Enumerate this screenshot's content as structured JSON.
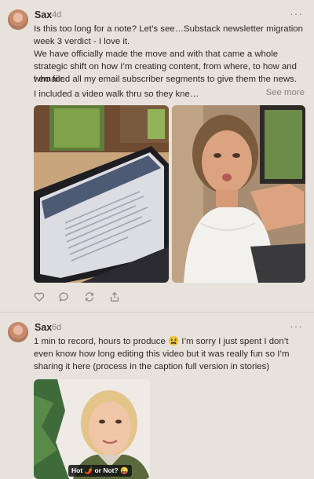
{
  "post1": {
    "author": "Sax",
    "age": "4d",
    "more_icon": "ellipsis-icon",
    "paragraphs": [
      "Is this too long for a note? Let’s see…Substack newsletter migration week 3 verdict - I love it.",
      "We have officially made the move and with that came a whole strategic shift on how I’m creating content, from where, to how and who for.",
      "I emailed all my email subscriber segments to give them the news.",
      "I included a video walk thru so they kne…"
    ],
    "see_more": "See more",
    "actions": [
      "heart-icon",
      "comment-icon",
      "restack-icon",
      "share-icon"
    ]
  },
  "post2": {
    "author": "Sax",
    "age": "6d",
    "more_icon": "ellipsis-icon",
    "text": "1 min to record, hours to produce 😫 I’m sorry I just spent I don’t even know how long editing this video but it was really fun so I’m sharing it here (process in the caption full version in stories)",
    "caption": "Hot 🌶️ or Not? 😜"
  }
}
